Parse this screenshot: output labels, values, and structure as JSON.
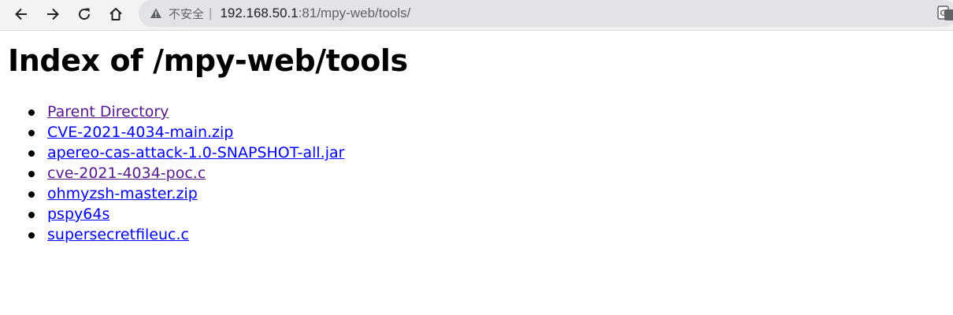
{
  "browser": {
    "security_text": "不安全",
    "separator": "|",
    "url_host": "192.168.50.1",
    "url_rest": ":81/mpy-web/tools/",
    "icons": {
      "back": "back-arrow-icon",
      "forward": "forward-arrow-icon",
      "reload": "reload-icon",
      "home": "home-icon",
      "security": "warning-triangle-icon",
      "translate": "translate-icon"
    }
  },
  "page": {
    "title": "Index of /mpy-web/tools",
    "items": [
      {
        "label": "Parent Directory",
        "visited": true
      },
      {
        "label": "CVE-2021-4034-main.zip",
        "visited": false
      },
      {
        "label": "apereo-cas-attack-1.0-SNAPSHOT-all.jar",
        "visited": false
      },
      {
        "label": "cve-2021-4034-poc.c",
        "visited": true
      },
      {
        "label": "ohmyzsh-master.zip",
        "visited": false
      },
      {
        "label": "pspy64s",
        "visited": false
      },
      {
        "label": "supersecretfileuc.c",
        "visited": false
      }
    ]
  },
  "colors": {
    "link": "#0000ee",
    "visited_link": "#551a8b",
    "text": "#000000",
    "toolbar_bg": "#f1f3f4",
    "omnibox_bg": "#e1e3e6"
  }
}
